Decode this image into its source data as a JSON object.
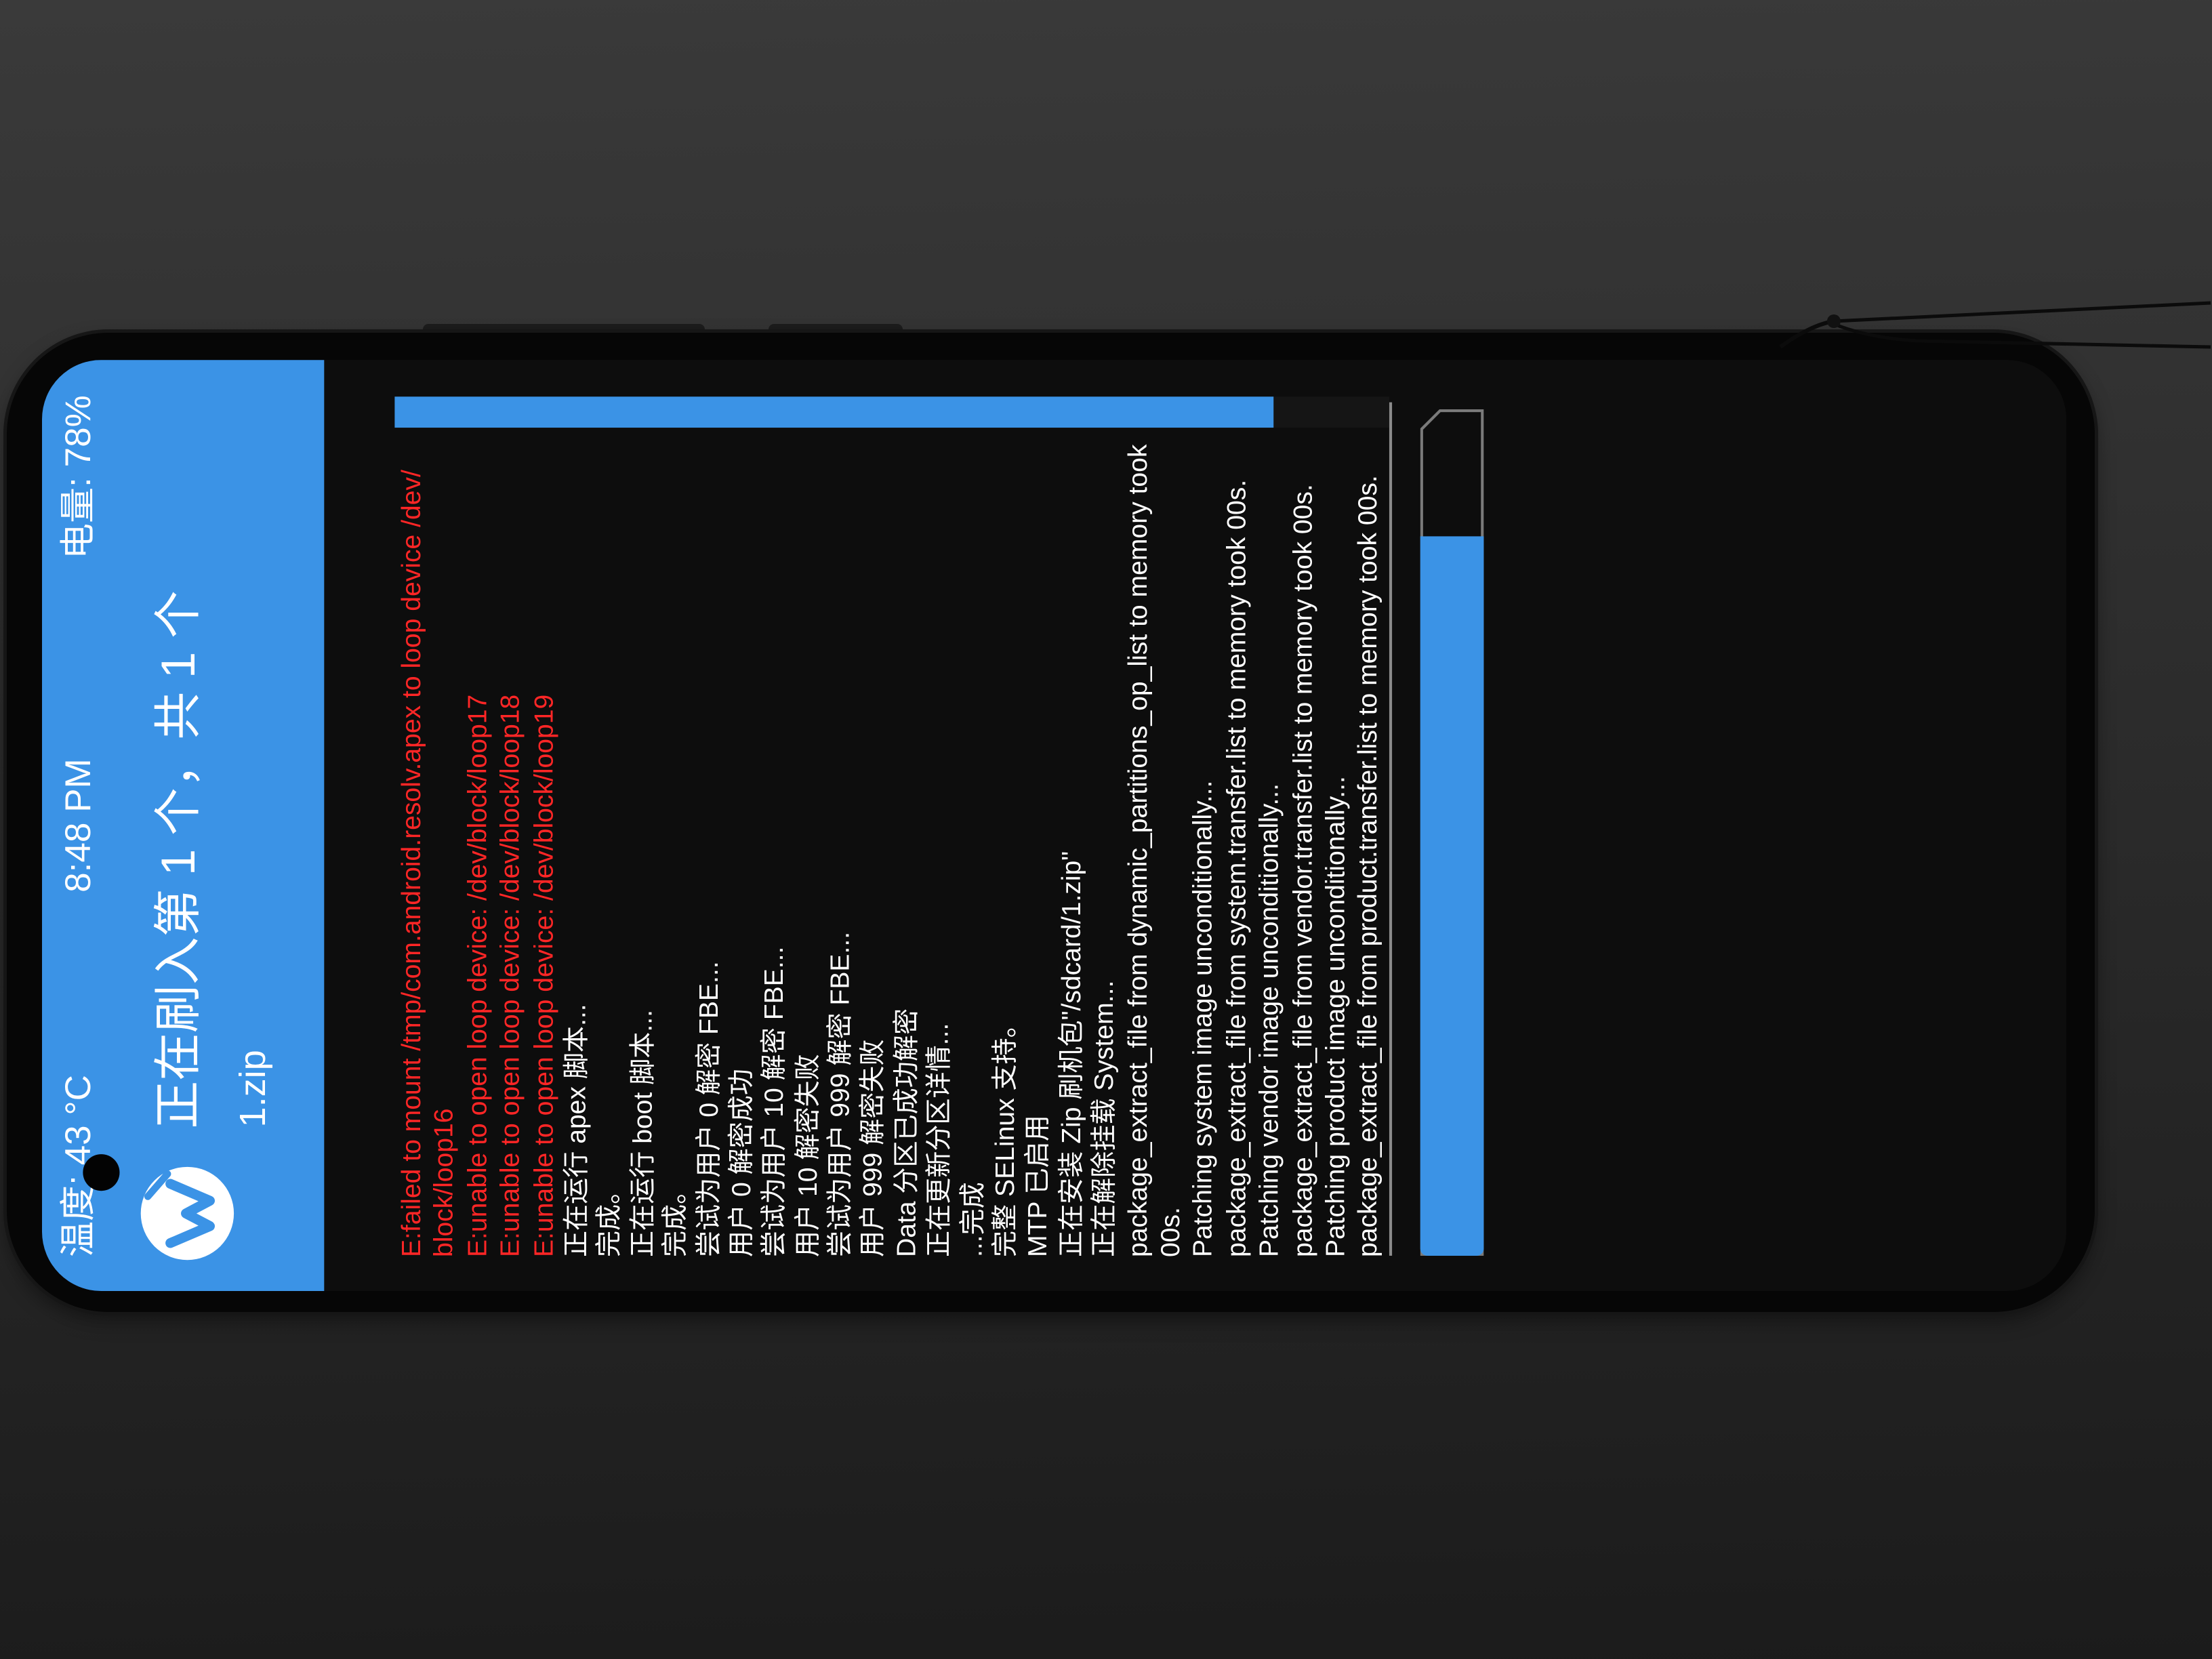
{
  "status_bar": {
    "temperature": "温度: 43 °C",
    "time": "8:48 PM",
    "battery": "电量: 78%"
  },
  "header": {
    "logo_icon": "twrp-logo-icon",
    "title": "正在刷入第 1 个，共 1 个",
    "subtitle": "1.zip"
  },
  "console": {
    "lines": [
      {
        "text": "E:failed to mount /tmp/com.android.resolv.apex to loop device /dev/",
        "error": true
      },
      {
        "text": "block/loop16",
        "error": true
      },
      {
        "text": "E:unable to open loop device: /dev/block/loop17",
        "error": true
      },
      {
        "text": "E:unable to open loop device: /dev/block/loop18",
        "error": true
      },
      {
        "text": "E:unable to open loop device: /dev/block/loop19",
        "error": true
      },
      {
        "text": "正在运行 apex 脚本...",
        "error": false
      },
      {
        "text": "完成。",
        "error": false
      },
      {
        "text": "正在运行 boot 脚本...",
        "error": false
      },
      {
        "text": "完成。",
        "error": false
      },
      {
        "text": "尝试为用户 0 解密 FBE...",
        "error": false
      },
      {
        "text": "用户 0 解密成功",
        "error": false
      },
      {
        "text": "尝试为用户 10 解密 FBE...",
        "error": false
      },
      {
        "text": "用户 10 解密失败",
        "error": false
      },
      {
        "text": "尝试为用户 999 解密 FBE...",
        "error": false
      },
      {
        "text": "用户 999 解密失败",
        "error": false
      },
      {
        "text": "Data 分区已成功解密",
        "error": false
      },
      {
        "text": "正在更新分区详情...",
        "error": false
      },
      {
        "text": "...完成",
        "error": false
      },
      {
        "text": "完整 SELinux 支持。",
        "error": false
      },
      {
        "text": "MTP 已启用",
        "error": false
      },
      {
        "text": "正在安装 Zip 刷机包\"/sdcard/1.zip\"",
        "error": false
      },
      {
        "text": "正在解除挂载 System...",
        "error": false
      },
      {
        "text": "package_extract_file from dynamic_partitions_op_list to memory took",
        "error": false
      },
      {
        "text": "00s.",
        "error": false
      },
      {
        "text": "Patching system image unconditionally...",
        "error": false
      },
      {
        "text": "package_extract_file from system.transfer.list to memory took 00s.",
        "error": false
      },
      {
        "text": "Patching vendor image unconditionally...",
        "error": false
      },
      {
        "text": "package_extract_file from vendor.transfer.list to memory took 00s.",
        "error": false
      },
      {
        "text": "Patching product image unconditionally...",
        "error": false
      },
      {
        "text": "package_extract_file from product.transfer.list to memory took 00s.",
        "error": false
      }
    ]
  },
  "progress": {
    "percent": 85
  },
  "colors": {
    "accent": "#3b93e6",
    "error": "#ff2626",
    "text": "#ffffff",
    "screen_background": "#0d0d0d"
  }
}
